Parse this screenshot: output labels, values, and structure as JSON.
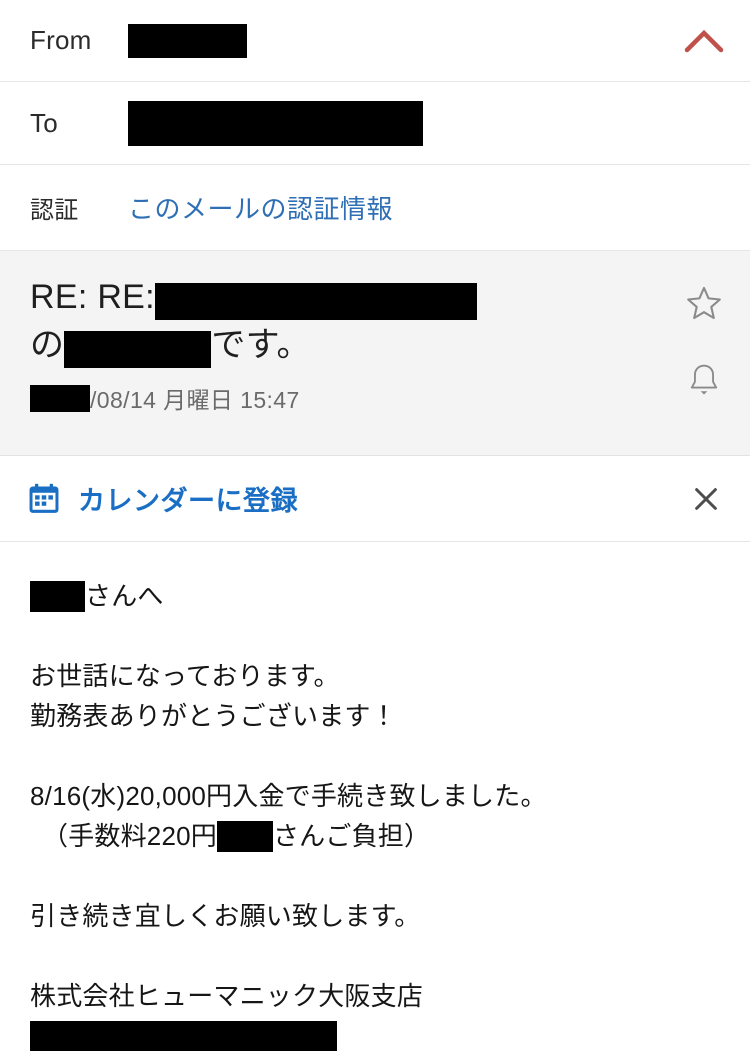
{
  "header": {
    "from_label": "From",
    "from_value_redacted": true,
    "to_label": "To",
    "to_value_redacted": true,
    "auth_label": "認証",
    "auth_link": "このメールの認証情報",
    "collapse_icon": "chevron-up-icon",
    "collapse_icon_color": "#c0504a"
  },
  "subject": {
    "prefix": "RE: RE:",
    "line2_prefix": "の",
    "line2_suffix": "です。",
    "redacted_segments": 2,
    "date_prefix_redacted": true,
    "date": "/08/14 月曜日 15:47",
    "star_icon": "star-outline-icon",
    "bell_icon": "bell-outline-icon",
    "background": "#f4f4f4"
  },
  "calendar_banner": {
    "icon": "calendar-icon",
    "label": "カレンダーに登録",
    "close_icon": "close-icon",
    "accent_color": "#1a6fc4"
  },
  "body": {
    "greeting_suffix": "さんへ",
    "para1_line1": "お世話になっております。",
    "para1_line2": "勤務表ありがとうございます！",
    "para2_line1": "8/16(水)20,000円入金で手続き致しました。",
    "para2_line2_prefix": "（手数料220円",
    "para2_line2_suffix": "さんご負担）",
    "para3": "引き続き宜しくお願い致します。",
    "signature_company": "株式会社ヒューマニック大阪支店",
    "signature_redacted": true
  }
}
